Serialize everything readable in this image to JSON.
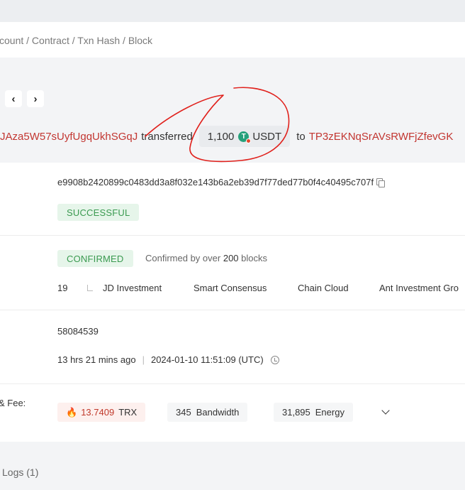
{
  "search": {
    "placeholder": "count / Contract / Txn Hash / Block"
  },
  "nav": {
    "prev_label": "‹",
    "next_label": "›"
  },
  "summary": {
    "from_address": "JAza5W57sUyfUgqUkhSGqJ",
    "transferred_word": "transferred",
    "amount": "1,100",
    "token_symbol": "USDT",
    "to_word": "to",
    "to_address": "TP3zEKNqSrAVsRWFjZfevGK"
  },
  "details": {
    "hash": "e9908b2420899c0483dd3a8f032e143b6a2eb39d7f77ded77b0f4c40495c707f",
    "result_status": "SUCCESSFUL",
    "confirm_status": "CONFIRMED",
    "confirm_prefix": "Confirmed by over",
    "confirm_count": "200",
    "confirm_suffix": "blocks",
    "sr_count": "19",
    "sr_list": [
      "JD Investment",
      "Smart Consensus",
      "Chain Cloud",
      "Ant Investment Gro"
    ],
    "block": "58084539",
    "time_ago": "13 hrs 21 mins ago",
    "timestamp": "2024-01-10 11:51:09 (UTC)",
    "fee_label": "& Fee:",
    "trx_amount": "13.7409",
    "trx_unit": "TRX",
    "bandwidth_amount": "345",
    "bandwidth_unit": "Bandwidth",
    "energy_amount": "31,895",
    "energy_unit": "Energy"
  },
  "logs_tab": "Logs (1)",
  "colors": {
    "address_red": "#c23631",
    "success_green": "#3a9a50",
    "annotation_red": "#e0201b",
    "usdt_green": "#26a17b"
  },
  "icons": [
    "prev-chevron-icon",
    "next-chevron-icon",
    "usdt-token-icon",
    "copy-icon",
    "tree-branch-icon",
    "clock-icon",
    "fire-icon",
    "chevron-down-icon"
  ]
}
